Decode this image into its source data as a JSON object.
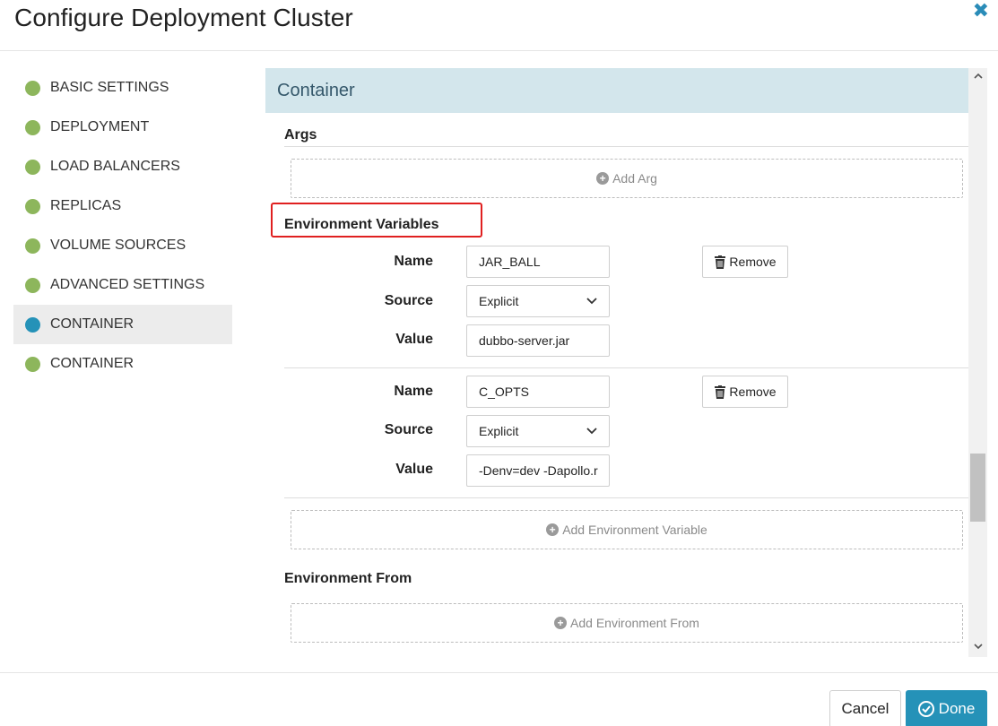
{
  "dialog": {
    "title": "Configure Deployment Cluster",
    "close_glyph": "✖"
  },
  "sidebar": {
    "items": [
      {
        "label": "BASIC SETTINGS",
        "status": "complete"
      },
      {
        "label": "DEPLOYMENT",
        "status": "complete"
      },
      {
        "label": "LOAD BALANCERS",
        "status": "complete"
      },
      {
        "label": "REPLICAS",
        "status": "complete"
      },
      {
        "label": "VOLUME SOURCES",
        "status": "complete"
      },
      {
        "label": "ADVANCED SETTINGS",
        "status": "complete"
      },
      {
        "label": "CONTAINER",
        "status": "active"
      },
      {
        "label": "CONTAINER",
        "status": "complete"
      }
    ]
  },
  "section": {
    "title": "Container",
    "args_title": "Args",
    "add_arg": "Add Arg",
    "env_title": "Environment Variables",
    "env_from_title": "Environment From",
    "add_env_var": "Add Environment Variable",
    "add_env_from": "Add Environment From"
  },
  "labels": {
    "name": "Name",
    "source": "Source",
    "value": "Value",
    "remove": "Remove"
  },
  "env_vars": [
    {
      "name": "JAR_BALL",
      "source": "Explicit",
      "value": "dubbo-server.jar"
    },
    {
      "name": "C_OPTS",
      "source": "Explicit",
      "value": "-Denv=dev -Dapollo.r"
    }
  ],
  "footer": {
    "cancel": "Cancel",
    "done": "Done"
  },
  "colors": {
    "accent": "#2592b8",
    "complete_dot": "#8db65c",
    "highlight": "#e02020",
    "section_header_bg": "#d3e6ec"
  }
}
